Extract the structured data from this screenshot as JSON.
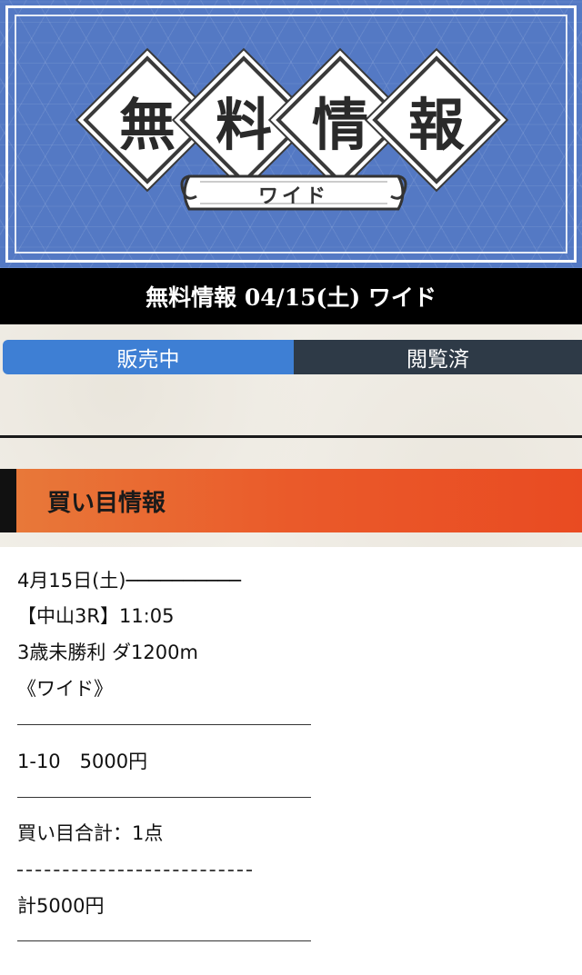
{
  "banner": {
    "chars": [
      "無",
      "料",
      "情",
      "報"
    ],
    "ribbon_label": "ワイド",
    "accent_color": "#5479c4"
  },
  "title_bar": {
    "text": "無料情報 04/15(土) ワイド"
  },
  "tabs": {
    "active_label": "販売中",
    "viewed_label": "閲覧済"
  },
  "section": {
    "title": "買い目情報"
  },
  "content": {
    "date_line": "4月15日(土)──────────",
    "race_line": "【中山3R】11:05",
    "class_line": "3歳未勝利 ダ1200m",
    "bet_type": "《ワイド》",
    "bet_line": "1-10　5000円",
    "total_points": "買い目合計：1点",
    "total_amount": "計5000円"
  }
}
